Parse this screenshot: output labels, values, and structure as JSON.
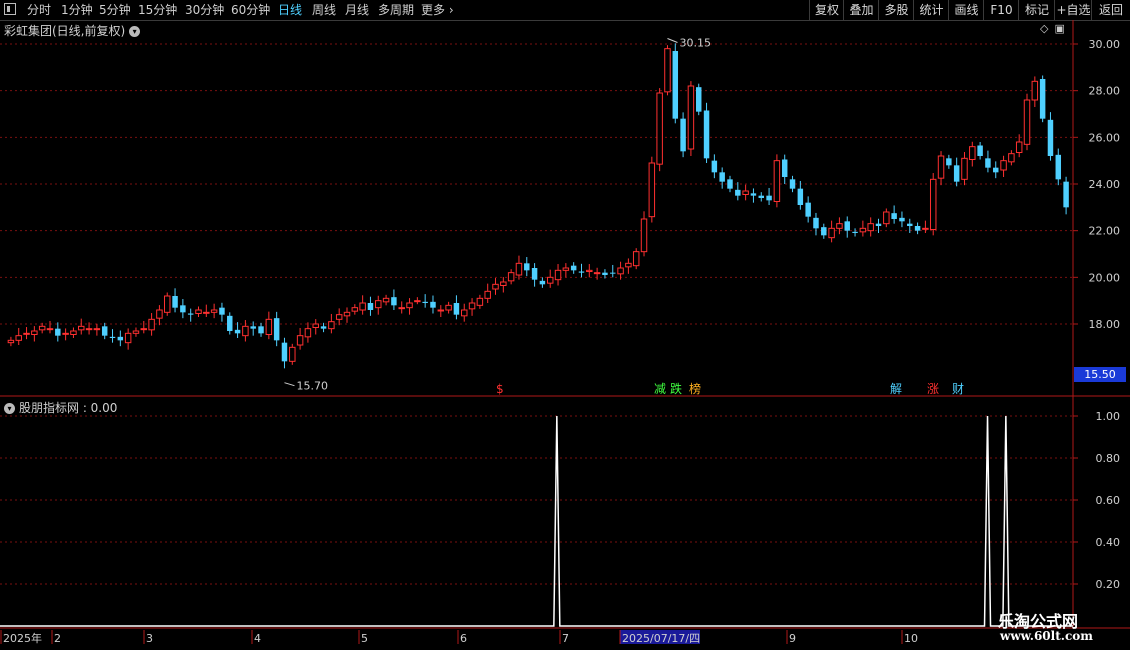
{
  "toolbar": {
    "period_tabs": [
      "分时",
      "1分钟",
      "5分钟",
      "15分钟",
      "30分钟",
      "60分钟",
      "日线",
      "周线",
      "月线",
      "多周期",
      "更多"
    ],
    "active_tab": "日线",
    "right_buttons": [
      "复权",
      "叠加",
      "多股",
      "统计",
      "画线",
      "F10",
      "标记",
      "+自选",
      "返回"
    ]
  },
  "upper_panel": {
    "title": "彩虹集团(日线,前复权)",
    "high_label": "30.15",
    "low_label": "15.70",
    "current_price": "15.50",
    "y_ticks": [
      "30.00",
      "28.00",
      "26.00",
      "24.00",
      "22.00",
      "20.00",
      "18.00"
    ],
    "events": [
      {
        "label": "$",
        "color": "#ff3030"
      },
      {
        "label": "减",
        "color": "#40ff40"
      },
      {
        "label": "跌",
        "color": "#40ff40"
      },
      {
        "label": "榜",
        "color": "#ffb020"
      },
      {
        "label": "解",
        "color": "#4fd0ff"
      },
      {
        "label": "涨",
        "color": "#ff3030"
      },
      {
        "label": "财",
        "color": "#4fd0ff"
      }
    ]
  },
  "lower_panel": {
    "title": "股朋指标网 : 0.00",
    "y_ticks": [
      "1.00",
      "0.80",
      "0.60",
      "0.40",
      "0.20"
    ]
  },
  "date_axis": {
    "labels": [
      "2025年",
      "2",
      "3",
      "4",
      "5",
      "6",
      "7",
      "2025/07/17/四",
      "9",
      "10"
    ]
  },
  "watermark": {
    "title": "乐淘公式网",
    "url": "www.60lt.com"
  },
  "colors": {
    "up": "#ff3030",
    "down": "#4fd0ff",
    "grid": "#7a1010",
    "axis": "#b01818",
    "highlight_date_bg": "#1a1a9a"
  },
  "chart_data": [
    {
      "type": "candlestick",
      "title": "彩虹集团(日线,前复权)",
      "ylim": [
        15.5,
        30.5
      ],
      "annotations": {
        "high": 30.15,
        "low": 15.7,
        "current": 15.5
      },
      "close_series": [
        17.3,
        17.5,
        17.6,
        17.7,
        17.9,
        17.8,
        17.5,
        17.6,
        17.7,
        17.9,
        17.8,
        17.8,
        17.5,
        17.4,
        17.3,
        17.6,
        17.7,
        17.8,
        18.2,
        18.6,
        19.2,
        18.7,
        18.5,
        18.4,
        18.6,
        18.5,
        18.6,
        18.4,
        17.7,
        17.6,
        17.9,
        17.8,
        17.6,
        18.2,
        17.3,
        16.4,
        17.0,
        17.5,
        17.8,
        18.0,
        17.8,
        18.1,
        18.4,
        18.5,
        18.7,
        18.9,
        18.6,
        19.0,
        19.1,
        18.8,
        18.7,
        18.9,
        19.0,
        18.9,
        18.7,
        18.6,
        18.8,
        18.4,
        18.6,
        18.9,
        19.1,
        19.4,
        19.7,
        19.8,
        20.2,
        20.6,
        20.3,
        19.9,
        19.7,
        20.0,
        20.3,
        20.4,
        20.3,
        20.2,
        20.3,
        20.2,
        20.1,
        20.2,
        20.4,
        20.6,
        21.1,
        22.5,
        24.9,
        27.9,
        29.8,
        26.8,
        25.4,
        28.2,
        27.1,
        25.1,
        24.5,
        24.1,
        23.8,
        23.5,
        23.7,
        23.5,
        23.4,
        23.3,
        25.0,
        24.3,
        23.8,
        23.1,
        22.6,
        22.1,
        21.8,
        22.1,
        22.3,
        22.0,
        21.9,
        22.1,
        22.3,
        22.2,
        22.8,
        22.5,
        22.4,
        22.2,
        22.0,
        22.1,
        24.2,
        25.2,
        24.8,
        24.1,
        25.1,
        25.6,
        25.2,
        24.7,
        24.5,
        25.0,
        25.3,
        25.8,
        27.6,
        28.4,
        26.8,
        25.2,
        24.2,
        23.0
      ]
    },
    {
      "type": "line",
      "title": "股朋指标网",
      "ylim": [
        0,
        1.0
      ],
      "spikes": [
        {
          "index": 120,
          "value": 1.0
        },
        {
          "index": 214,
          "value": 1.0
        },
        {
          "index": 218,
          "value": 1.0
        }
      ]
    }
  ]
}
